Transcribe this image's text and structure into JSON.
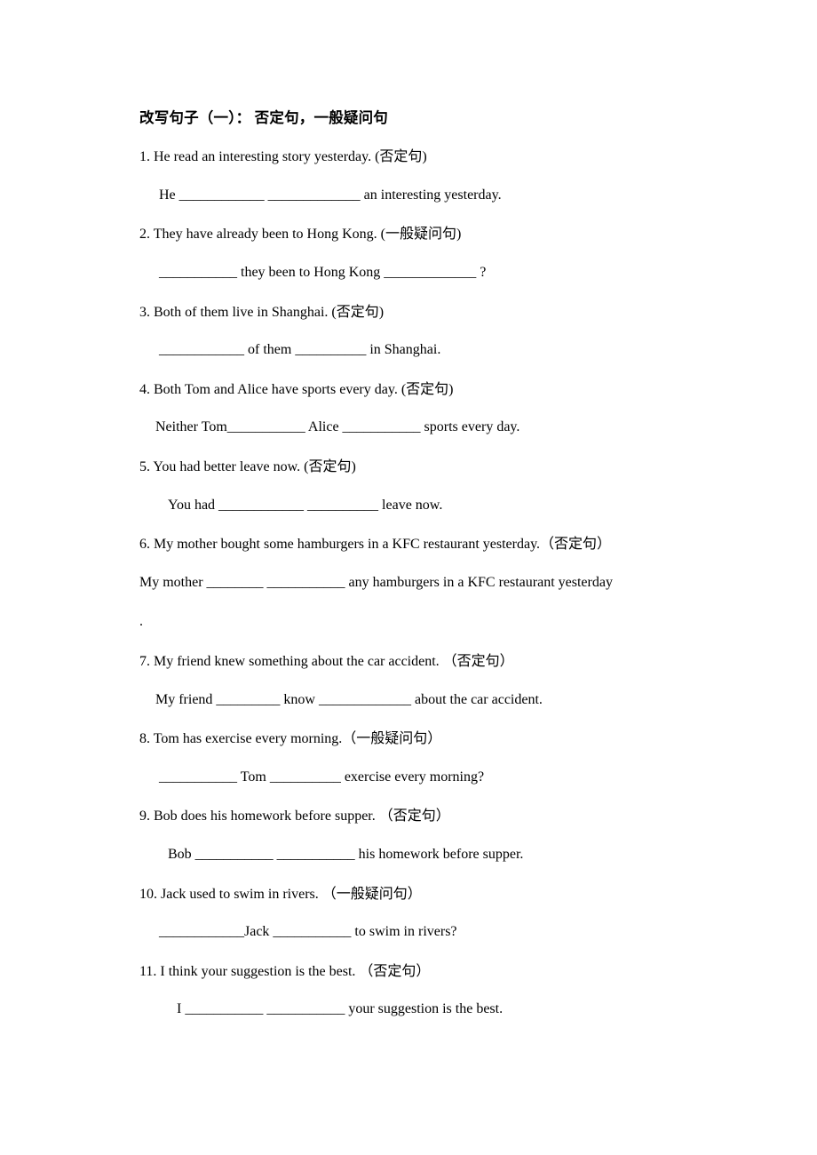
{
  "document": {
    "title": "改写句子（一）： 否定句，一般疑问句",
    "items": [
      {
        "number": "1.",
        "question": "1. He read an interesting story yesterday. (否定句)",
        "answer": "He ____________ _____________ an interesting yesterday.",
        "answer_indent": "ind-2"
      },
      {
        "number": "2.",
        "question": "2. They have already been to Hong Kong. (一般疑问句)",
        "answer": "___________ they been to Hong Kong _____________ ?",
        "answer_indent": "ind-2"
      },
      {
        "number": "3.",
        "question": "3. Both of them live in Shanghai. (否定句)",
        "answer": "____________ of them __________ in Shanghai.",
        "answer_indent": "ind-2"
      },
      {
        "number": "4.",
        "question": "4. Both Tom and Alice have sports every day. (否定句)",
        "answer": "Neither Tom___________ Alice ___________ sports every day.",
        "answer_indent": "ind-1"
      },
      {
        "number": "5.",
        "question": "5. You had better leave now. (否定句)",
        "answer": "You had ____________ __________ leave now.",
        "answer_indent": "ind-3"
      },
      {
        "number": "6.",
        "question": "6. My mother bought some hamburgers in a KFC restaurant yesterday.（否定句）",
        "answer": "My mother ________ ___________ any hamburgers in a KFC restaurant yesterday",
        "answer_indent": "ind-0",
        "trailing": ".",
        "wide": true
      },
      {
        "number": "7.",
        "question": "7. My friend knew something about the car accident. （否定句）",
        "answer": "My friend _________ know _____________ about the car accident.",
        "answer_indent": "ind-1"
      },
      {
        "number": "8.",
        "question": "8. Tom has exercise every morning.（一般疑问句）",
        "answer": "___________ Tom __________ exercise every morning?",
        "answer_indent": "ind-2"
      },
      {
        "number": "9.",
        "question": "9. Bob does his homework before supper. （否定句）",
        "answer": "Bob ___________ ___________ his homework before supper.",
        "answer_indent": "ind-3"
      },
      {
        "number": "10.",
        "question": "10. Jack used to swim in rivers. （一般疑问句）",
        "answer": "____________Jack ___________ to swim in rivers?",
        "answer_indent": "ind-2"
      },
      {
        "number": "11.",
        "question": "11. I think your suggestion is the best. （否定句）",
        "answer": "I ___________ ___________ your suggestion is the best.",
        "answer_indent": "ind-4"
      }
    ]
  }
}
